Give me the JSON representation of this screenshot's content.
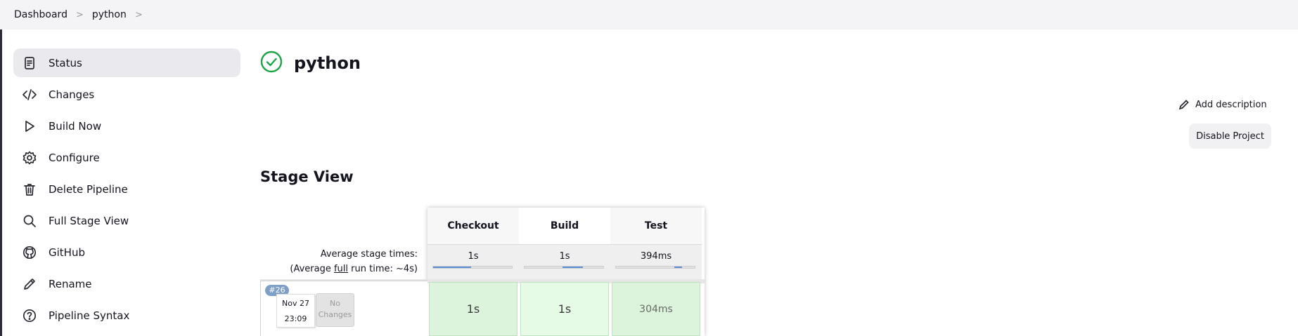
{
  "breadcrumb": {
    "items": [
      "Dashboard",
      "python"
    ],
    "separator": ">"
  },
  "sidebar": {
    "items": [
      {
        "label": "Status",
        "icon": "status-icon",
        "active": true
      },
      {
        "label": "Changes",
        "icon": "code-icon"
      },
      {
        "label": "Build Now",
        "icon": "play-icon"
      },
      {
        "label": "Configure",
        "icon": "gear-icon"
      },
      {
        "label": "Delete Pipeline",
        "icon": "trash-icon"
      },
      {
        "label": "Full Stage View",
        "icon": "search-icon"
      },
      {
        "label": "GitHub",
        "icon": "github-icon"
      },
      {
        "label": "Rename",
        "icon": "pencil-icon"
      },
      {
        "label": "Pipeline Syntax",
        "icon": "help-icon"
      }
    ]
  },
  "page": {
    "title": "python",
    "status": "success",
    "add_description_label": "Add description",
    "disable_label": "Disable Project"
  },
  "stage_view": {
    "title": "Stage View",
    "avg_label_line1": "Average stage times:",
    "avg_label_line2_pre": "(Average ",
    "avg_label_line2_link": "full",
    "avg_label_line2_post": " run time: ~4s)",
    "stages": [
      {
        "name": "Checkout",
        "avg": "1s",
        "bar_from": 0.0,
        "bar_to": 0.48
      },
      {
        "name": "Build",
        "avg": "1s",
        "bar_from": 0.48,
        "bar_to": 0.74
      },
      {
        "name": "Test",
        "avg": "394ms",
        "bar_from": 0.74,
        "bar_to": 0.84
      }
    ],
    "runs": [
      {
        "badge": "#26",
        "date": "Nov 27",
        "time": "23:09",
        "changes_line1": "No",
        "changes_line2": "Changes",
        "cells": [
          "1s",
          "1s",
          "304ms"
        ]
      }
    ]
  },
  "colors": {
    "success": "#1ea446",
    "bar": "#5b8fd6",
    "cell_green": "#dcf4dc"
  }
}
